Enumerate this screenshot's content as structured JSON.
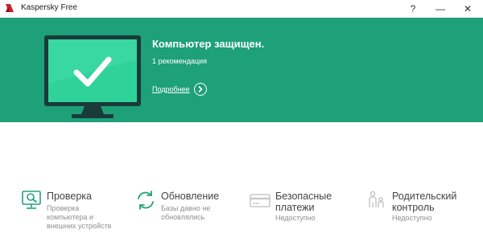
{
  "window": {
    "title": "Kaspersky Free",
    "help_label": "?",
    "minimize_label": "—",
    "close_label": "✕"
  },
  "colors": {
    "banner_green": "#1ea078",
    "accent_green": "#24a27c",
    "logo_red": "#d0202f"
  },
  "status": {
    "title": "Компьютер защищен.",
    "subtitle": "1 рекомендация",
    "details_label": "Подробнее"
  },
  "tiles": [
    {
      "id": "scan",
      "icon": "scan-icon",
      "title": "Проверка",
      "desc_lines": [
        "Проверка",
        "компьютера и",
        "внешних устройств"
      ]
    },
    {
      "id": "update",
      "icon": "update-icon",
      "title": "Обновление",
      "desc_lines": [
        "Базы давно не",
        "обновлялись"
      ]
    },
    {
      "id": "safe_money",
      "icon": "card-icon",
      "title_lines": [
        "Безопасные",
        "платежи"
      ],
      "desc_lines": [
        "Недоступно"
      ]
    },
    {
      "id": "parental",
      "icon": "family-icon",
      "title_lines": [
        "Родительский",
        "контроль"
      ],
      "desc_lines": [
        "Недоступно"
      ]
    }
  ]
}
